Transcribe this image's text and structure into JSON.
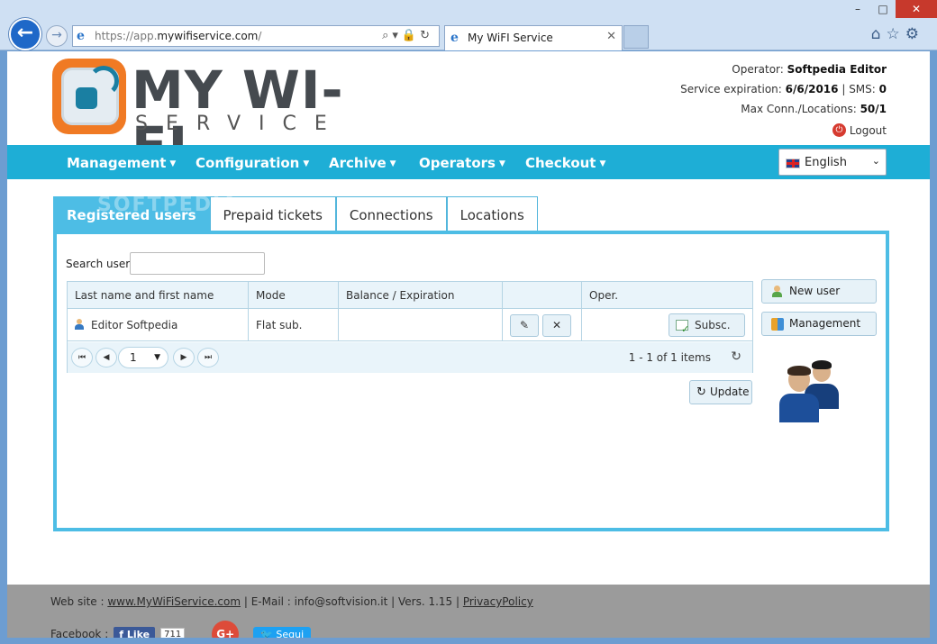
{
  "browser": {
    "url_prefix": "https://app.",
    "url_domain": "mywifiservice.com",
    "url_suffix": "/",
    "tab_title": "My WiFI Service",
    "addr_tools": "⌕▾🔒↻",
    "tab_close": "✕",
    "back_glyph": "←",
    "fwd_glyph": "→",
    "ie_glyph": "e",
    "win_buttons": [
      "–",
      "□",
      "✕"
    ],
    "fav_buttons": "⌂☆⚙"
  },
  "logo": {
    "name": "MY WI-FI",
    "sub": "SERVICE"
  },
  "operator": {
    "operator_label": "Operator: ",
    "operator_value": "Softpedia Editor",
    "expiration_label": "Service expiration: ",
    "expiration_value": "6/6/2016",
    "sms_label": " | SMS: ",
    "sms_value": "0",
    "conn_label": "Max Conn./Locations: ",
    "conn_value": "50/1",
    "logout": "Logout",
    "logout_glyph": "⏻"
  },
  "menu": {
    "items": [
      "Management",
      "Configuration",
      "Archive",
      "Operators",
      "Checkout"
    ],
    "caret": "▼",
    "language": "English",
    "language_caret": "⌄"
  },
  "tabs": [
    "Registered users",
    "Prepaid tickets",
    "Connections",
    "Locations"
  ],
  "search": {
    "label": "Search user",
    "value": "",
    "placeholder": ""
  },
  "grid": {
    "columns": [
      "Last name and first name",
      "Mode",
      "Balance / Expiration",
      "",
      "Oper."
    ],
    "rows": [
      {
        "name": "Editor Softpedia",
        "mode": "Flat sub.",
        "balance": "",
        "subscribe": "Subsc."
      }
    ],
    "edit_glyph": "✎",
    "delete_glyph": "✕",
    "pager": {
      "page": "1",
      "info": "1 - 1 of 1 items",
      "first_glyph": "⏮",
      "prev_glyph": "◀",
      "next_glyph": "▶",
      "last_glyph": "⏭",
      "select_caret": "▼",
      "refresh_glyph": "↻"
    }
  },
  "buttons": {
    "update": "Update",
    "update_glyph": "↻",
    "new_user": "New user",
    "management": "Management"
  },
  "footer": {
    "website_label": "Web site : ",
    "website_link": "www.MyWiFiService.com",
    "email": " | E-Mail : info@softvision.it | Vers. 1.15 | ",
    "privacy": "PrivacyPolicy",
    "facebook_label": "Facebook :",
    "fb_like": "f Like",
    "fb_count": "711",
    "gplus": "G+",
    "twitter": "🐦 Segui"
  },
  "watermark": "SOFTPEDIA",
  "colors": {
    "menu_bar": "#1eaed6",
    "tab_active": "#4dbde5",
    "logo_orange": "#f07a24",
    "logo_blue": "#1a7fa2"
  }
}
